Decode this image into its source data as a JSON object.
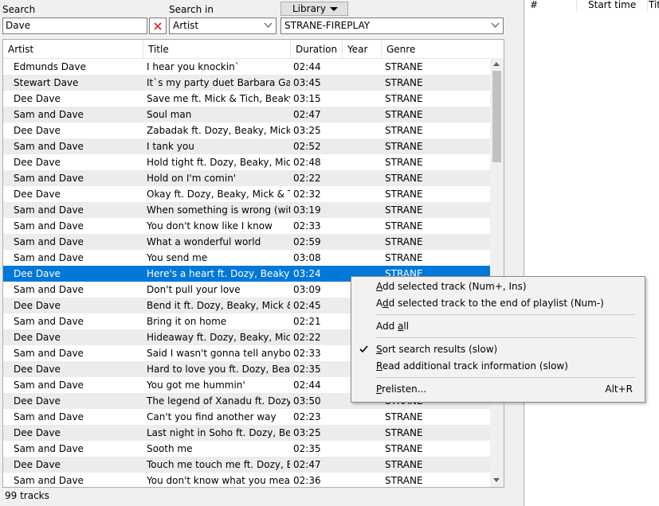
{
  "search": {
    "label": "Search",
    "value": "Dave",
    "search_in_label": "Search in",
    "search_in_value": "Artist",
    "library_button": "Library",
    "library_value": "STRANE-FIREPLAY"
  },
  "columns": [
    "Artist",
    "Title",
    "Duration",
    "Year",
    "Genre"
  ],
  "tracks": [
    {
      "artist": "Edmunds Dave",
      "title": "I hear you knockin`",
      "duration": "02:44",
      "year": "",
      "genre": "STRANE"
    },
    {
      "artist": "Stewart Dave",
      "title": "It`s my party duet Barbara Gaskin",
      "duration": "03:45",
      "year": "",
      "genre": "STRANE"
    },
    {
      "artist": "Dee Dave",
      "title": "Save me ft. Mick & Tich, Beaky ...",
      "duration": "03:15",
      "year": "",
      "genre": "STRANE"
    },
    {
      "artist": "Sam and Dave",
      "title": "Soul man",
      "duration": "02:47",
      "year": "",
      "genre": "STRANE"
    },
    {
      "artist": "Dee Dave",
      "title": "Zabadak ft. Dozy, Beaky, Mick &...",
      "duration": "03:25",
      "year": "",
      "genre": "STRANE"
    },
    {
      "artist": "Sam and Dave",
      "title": "I tank you",
      "duration": "02:52",
      "year": "",
      "genre": "STRANE"
    },
    {
      "artist": "Dee Dave",
      "title": "Hold tight ft. Dozy, Beaky, Mick ...",
      "duration": "02:48",
      "year": "",
      "genre": "STRANE"
    },
    {
      "artist": "Sam and Dave",
      "title": "Hold on I'm comin'",
      "duration": "02:22",
      "year": "",
      "genre": "STRANE"
    },
    {
      "artist": "Dee Dave",
      "title": "Okay ft. Dozy, Beaky, Mick & Tich",
      "duration": "02:32",
      "year": "",
      "genre": "STRANE"
    },
    {
      "artist": "Sam and Dave",
      "title": "When something is wrong (with...",
      "duration": "03:19",
      "year": "",
      "genre": "STRANE"
    },
    {
      "artist": "Sam and Dave",
      "title": "You don't know like I know",
      "duration": "02:33",
      "year": "",
      "genre": "STRANE"
    },
    {
      "artist": "Sam and Dave",
      "title": "What a wonderful world",
      "duration": "02:59",
      "year": "",
      "genre": "STRANE"
    },
    {
      "artist": "Sam and Dave",
      "title": "You send me",
      "duration": "03:08",
      "year": "",
      "genre": "STRANE"
    },
    {
      "artist": "Dee Dave",
      "title": "Here's a heart ft. Dozy, Beaky, M...",
      "duration": "03:24",
      "year": "",
      "genre": "STRANE"
    },
    {
      "artist": "Sam and Dave",
      "title": "Don't pull your love",
      "duration": "03:09",
      "year": "",
      "genre": "STRANE"
    },
    {
      "artist": "Dee Dave",
      "title": "Bend it ft. Dozy, Beaky, Mick & ...",
      "duration": "02:45",
      "year": "",
      "genre": "STRANE"
    },
    {
      "artist": "Sam and Dave",
      "title": "Bring it on home",
      "duration": "02:21",
      "year": "",
      "genre": "STRANE"
    },
    {
      "artist": "Dee Dave",
      "title": "Hideaway ft. Dozy, Beaky, Mick ...",
      "duration": "02:22",
      "year": "",
      "genre": "STRANE"
    },
    {
      "artist": "Sam and Dave",
      "title": "Said I wasn't gonna tell anybody",
      "duration": "02:33",
      "year": "",
      "genre": "STRANE"
    },
    {
      "artist": "Dee Dave",
      "title": "Hard to love you ft. Dozy, Beaky,...",
      "duration": "02:35",
      "year": "",
      "genre": "STRANE"
    },
    {
      "artist": "Sam and Dave",
      "title": "You got me hummin'",
      "duration": "02:44",
      "year": "",
      "genre": "STRANE"
    },
    {
      "artist": "Dee Dave",
      "title": "The legend of Xanadu ft. Dozy, ...",
      "duration": "03:50",
      "year": "",
      "genre": "STRANE"
    },
    {
      "artist": "Sam and Dave",
      "title": "Can't you find another way",
      "duration": "02:23",
      "year": "",
      "genre": "STRANE"
    },
    {
      "artist": "Dee Dave",
      "title": "Last night in Soho ft. Dozy, Beak...",
      "duration": "03:25",
      "year": "",
      "genre": "STRANE"
    },
    {
      "artist": "Sam and Dave",
      "title": "Sooth me",
      "duration": "02:35",
      "year": "",
      "genre": "STRANE"
    },
    {
      "artist": "Dee Dave",
      "title": "Touch me touch me ft. Dozy, Be...",
      "duration": "02:47",
      "year": "",
      "genre": "STRANE"
    },
    {
      "artist": "Sam and Dave",
      "title": "You don't know what you mean ...",
      "duration": "02:36",
      "year": "",
      "genre": "STRANE"
    }
  ],
  "selected_index": 13,
  "status": {
    "count": "99 tracks"
  },
  "playlist": {
    "columns": [
      "#",
      "Start time",
      "Tit"
    ]
  },
  "context_menu": {
    "items": [
      {
        "pre": "",
        "u": "A",
        "post": "dd selected track (Num+, Ins)",
        "shortcut": "",
        "checked": false
      },
      {
        "pre": "A",
        "u": "d",
        "post": "d selected track to the end of playlist (Num-)",
        "shortcut": "",
        "checked": false
      },
      {
        "pre": "Add ",
        "u": "a",
        "post": "ll",
        "shortcut": "",
        "checked": false
      },
      {
        "pre": "",
        "u": "S",
        "post": "ort search results (slow)",
        "shortcut": "",
        "checked": true
      },
      {
        "pre": "",
        "u": "R",
        "post": "ead additional track information (slow)",
        "shortcut": "",
        "checked": false
      },
      {
        "pre": "",
        "u": "P",
        "post": "relisten...",
        "shortcut": "Alt+R",
        "checked": false
      }
    ]
  },
  "icons": {
    "clear": "close-icon",
    "check": "checkmark-icon"
  },
  "colors": {
    "selection": "#0078d7",
    "clear_x": "#d32f2f"
  }
}
